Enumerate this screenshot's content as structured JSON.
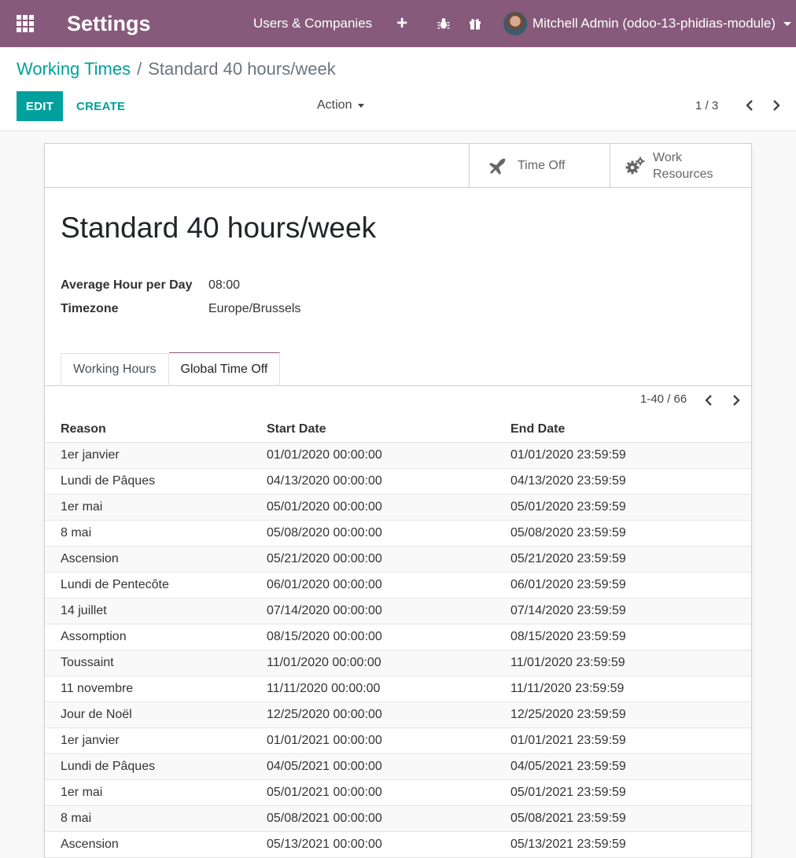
{
  "navbar": {
    "app_title": "Settings",
    "menu_users": "Users & Companies",
    "plus": "+",
    "user_name": "Mitchell Admin (odoo-13-phidias-module)",
    "colors": {
      "bar": "#875a7b",
      "accent": "#00a09d"
    }
  },
  "breadcrumb": {
    "parent": "Working Times",
    "separator": "/",
    "current": "Standard 40 hours/week"
  },
  "toolbar": {
    "edit_label": "EDIT",
    "create_label": "CREATE",
    "action_label": "Action",
    "pager": "1 / 3"
  },
  "stat_buttons": {
    "time_off": "Time Off",
    "work_resources": "Work Resources"
  },
  "record": {
    "title": "Standard 40 hours/week",
    "avg_hour_label": "Average Hour per Day",
    "avg_hour_value": "08:00",
    "timezone_label": "Timezone",
    "timezone_value": "Europe/Brussels"
  },
  "tabs": {
    "working_hours": "Working Hours",
    "global_time_off": "Global Time Off"
  },
  "list": {
    "pager": "1-40 / 66",
    "headers": {
      "reason": "Reason",
      "start": "Start Date",
      "end": "End Date"
    },
    "rows": [
      {
        "reason": "1er janvier",
        "start": "01/01/2020 00:00:00",
        "end": "01/01/2020 23:59:59"
      },
      {
        "reason": "Lundi de Pâques",
        "start": "04/13/2020 00:00:00",
        "end": "04/13/2020 23:59:59"
      },
      {
        "reason": "1er mai",
        "start": "05/01/2020 00:00:00",
        "end": "05/01/2020 23:59:59"
      },
      {
        "reason": "8 mai",
        "start": "05/08/2020 00:00:00",
        "end": "05/08/2020 23:59:59"
      },
      {
        "reason": "Ascension",
        "start": "05/21/2020 00:00:00",
        "end": "05/21/2020 23:59:59"
      },
      {
        "reason": "Lundi de Pentecôte",
        "start": "06/01/2020 00:00:00",
        "end": "06/01/2020 23:59:59"
      },
      {
        "reason": "14 juillet",
        "start": "07/14/2020 00:00:00",
        "end": "07/14/2020 23:59:59"
      },
      {
        "reason": "Assomption",
        "start": "08/15/2020 00:00:00",
        "end": "08/15/2020 23:59:59"
      },
      {
        "reason": "Toussaint",
        "start": "11/01/2020 00:00:00",
        "end": "11/01/2020 23:59:59"
      },
      {
        "reason": "11 novembre",
        "start": "11/11/2020 00:00:00",
        "end": "11/11/2020 23:59:59"
      },
      {
        "reason": "Jour de Noël",
        "start": "12/25/2020 00:00:00",
        "end": "12/25/2020 23:59:59"
      },
      {
        "reason": "1er janvier",
        "start": "01/01/2021 00:00:00",
        "end": "01/01/2021 23:59:59"
      },
      {
        "reason": "Lundi de Pâques",
        "start": "04/05/2021 00:00:00",
        "end": "04/05/2021 23:59:59"
      },
      {
        "reason": "1er mai",
        "start": "05/01/2021 00:00:00",
        "end": "05/01/2021 23:59:59"
      },
      {
        "reason": "8 mai",
        "start": "05/08/2021 00:00:00",
        "end": "05/08/2021 23:59:59"
      },
      {
        "reason": "Ascension",
        "start": "05/13/2021 00:00:00",
        "end": "05/13/2021 23:59:59"
      }
    ]
  }
}
